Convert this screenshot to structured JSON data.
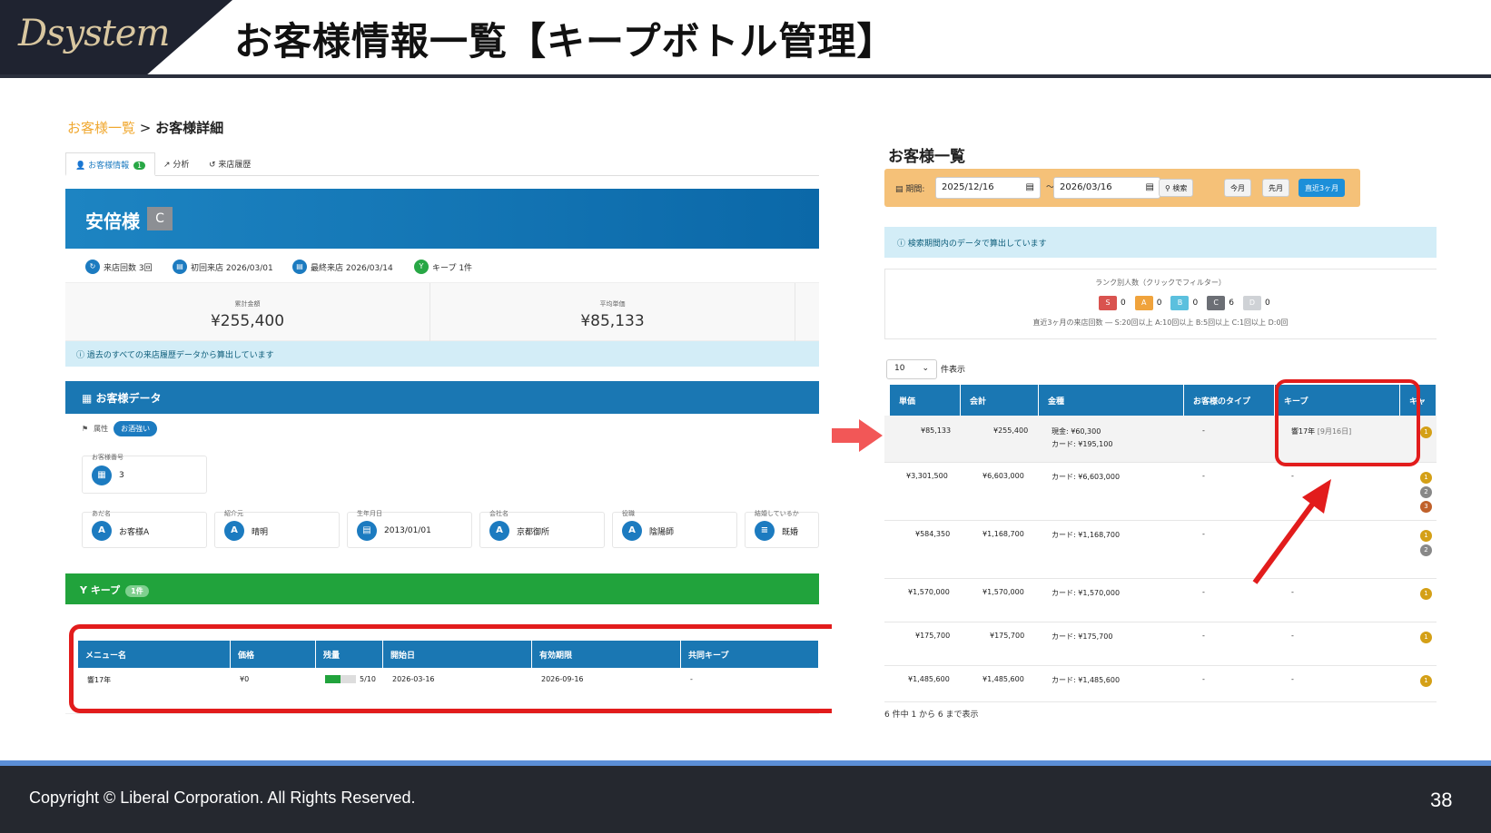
{
  "header": {
    "logo": "Dsystem",
    "title": "お客様情報一覧【キープボトル管理】"
  },
  "footer": {
    "copyright": "Copyright ©  Liberal Corporation. All Rights Reserved.",
    "page": "38"
  },
  "left": {
    "breadcrumb": {
      "link": "お客様一覧",
      "sep": ">",
      "current": "お客様詳細"
    },
    "tabs": [
      {
        "label": "お客様情報",
        "badge": "1"
      },
      {
        "label": "分析"
      },
      {
        "label": "来店履歴"
      }
    ],
    "customer": {
      "name": "安倍様",
      "rank": "C"
    },
    "stats": [
      {
        "label": "来店回数 3回"
      },
      {
        "label": "初回来店 2026/03/01"
      },
      {
        "label": "最終来店 2026/03/14"
      },
      {
        "label": "キープ 1件"
      }
    ],
    "totals": [
      {
        "label": "累計金額",
        "value": "¥255,400"
      },
      {
        "label": "平均単価",
        "value": "¥85,133"
      }
    ],
    "info": "過去のすべての来店履歴データから算出しています",
    "data_section": {
      "title": "お客様データ",
      "attr_label": "属性",
      "attr_value": "お酒強い",
      "number_label": "お客様番号",
      "number_value": "3",
      "fields": [
        {
          "label": "あだ名",
          "value": "お客様A",
          "icon": "A"
        },
        {
          "label": "紹介元",
          "value": "晴明",
          "icon": "A"
        },
        {
          "label": "生年月日",
          "value": "2013/01/01",
          "icon": "calendar"
        },
        {
          "label": "会社名",
          "value": "京都御所",
          "icon": "A"
        },
        {
          "label": "役職",
          "value": "陰陽師",
          "icon": "A"
        },
        {
          "label": "結婚しているか",
          "value": "既婚",
          "icon": "list"
        }
      ]
    },
    "keep_section": {
      "title": "キープ",
      "badge": "1件",
      "headers": [
        "メニュー名",
        "価格",
        "残量",
        "開始日",
        "有効期限",
        "共同キープ"
      ],
      "row": {
        "menu": "響17年",
        "price": "¥0",
        "remaining": "5/10",
        "remaining_fraction": 0.5,
        "start": "2026-03-16",
        "expiry": "2026-09-16",
        "shared": "-"
      }
    }
  },
  "right": {
    "title": "お客様一覧",
    "filter": {
      "label": "期間:",
      "from": "2025/12/16",
      "tilde": "〜",
      "to": "2026/03/16",
      "search": "検索",
      "btn_month": "今月",
      "btn_last": "先月",
      "btn_recent": "直近3ヶ月"
    },
    "info": "検索期間内のデータで算出しています",
    "rank_label": "ランク別人数（クリックでフィルター）",
    "ranks": [
      {
        "rank": "S",
        "count": "0",
        "color": "#d9534f"
      },
      {
        "rank": "A",
        "count": "0",
        "color": "#f0a33c"
      },
      {
        "rank": "B",
        "count": "0",
        "color": "#5bc0de"
      },
      {
        "rank": "C",
        "count": "6",
        "color": "#6c6f75"
      },
      {
        "rank": "D",
        "count": "0",
        "color": "#cfd2d6"
      }
    ],
    "rank_note": "直近3ヶ月の来店回数 ― S:20回以上 A:10回以上 B:5回以上 C:1回以上 D:0回",
    "length": {
      "value": "10",
      "label": "件表示"
    },
    "headers": [
      "単価",
      "会計",
      "金種",
      "お客様のタイプ",
      "キープ",
      "キャ"
    ],
    "rows": [
      {
        "unit": "¥85,133",
        "total": "¥255,400",
        "pay1": "現金:    ¥60,300",
        "pay2": "カード:  ¥195,100",
        "type": "-",
        "keep": "響17年",
        "keep_date": "[9月16日]",
        "nums": [
          "1"
        ]
      },
      {
        "unit": "¥3,301,500",
        "total": "¥6,603,000",
        "pay1": "カード:   ¥6,603,000",
        "pay2": "",
        "type": "-",
        "keep": "-",
        "keep_date": "",
        "nums": [
          "1",
          "2",
          "3"
        ]
      },
      {
        "unit": "¥584,350",
        "total": "¥1,168,700",
        "pay1": "カード:   ¥1,168,700",
        "pay2": "",
        "type": "-",
        "keep": "-",
        "keep_date": "",
        "nums": [
          "1",
          "2"
        ]
      },
      {
        "unit": "¥1,570,000",
        "total": "¥1,570,000",
        "pay1": "カード:   ¥1,570,000",
        "pay2": "",
        "type": "-",
        "keep": "-",
        "keep_date": "",
        "nums": [
          "1"
        ]
      },
      {
        "unit": "¥175,700",
        "total": "¥175,700",
        "pay1": "カード:   ¥175,700",
        "pay2": "",
        "type": "-",
        "keep": "-",
        "keep_date": "",
        "nums": [
          "1"
        ]
      },
      {
        "unit": "¥1,485,600",
        "total": "¥1,485,600",
        "pay1": "カード:   ¥1,485,600",
        "pay2": "",
        "type": "-",
        "keep": "-",
        "keep_date": "",
        "nums": [
          "1"
        ]
      }
    ],
    "footer_text": "6 件中 1 から 6 まで表示"
  }
}
